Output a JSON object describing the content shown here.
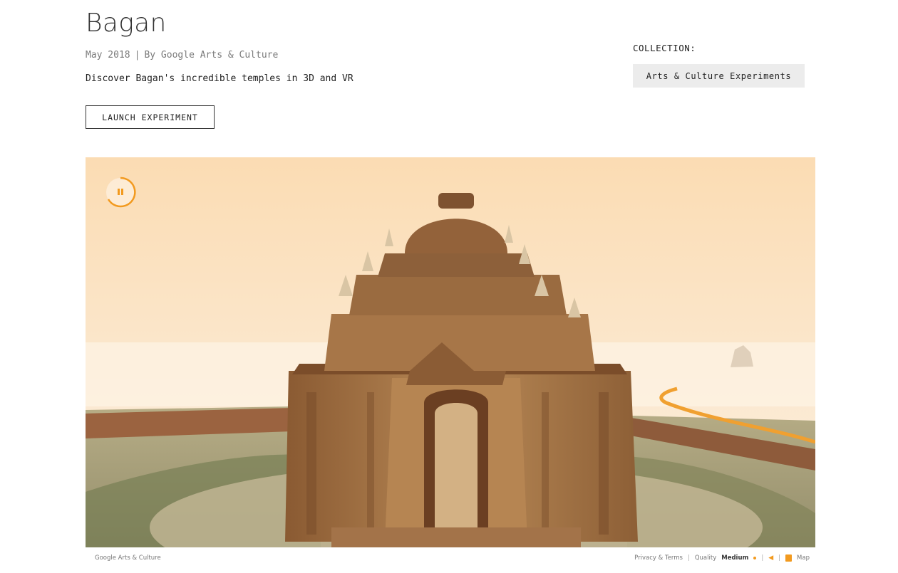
{
  "header": {
    "title": "Bagan",
    "date": "May 2018",
    "separator": "|",
    "byline": "By Google Arts & Culture",
    "description": "Discover Bagan's incredible temples in 3D and VR",
    "launch_label": "LAUNCH EXPERIMENT"
  },
  "collection": {
    "label": "COLLECTION:",
    "name": "Arts & Culture Experiments"
  },
  "media": {
    "pause_icon": "pause-icon",
    "accent_color": "#f29a1f",
    "footer": {
      "brand": "Google Arts & Culture",
      "privacy": "Privacy & Terms",
      "divider": "|",
      "quality_label": "Quality",
      "quality_value": "Medium",
      "map_label": "Map"
    }
  }
}
